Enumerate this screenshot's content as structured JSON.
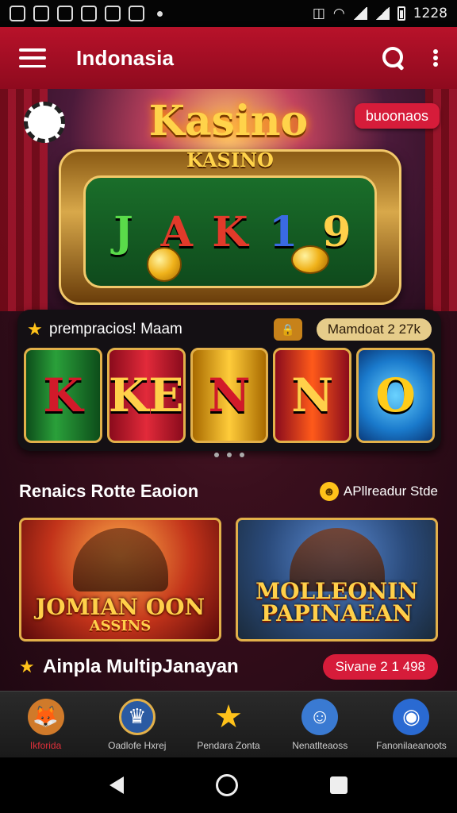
{
  "status": {
    "time": "1228"
  },
  "app_bar": {
    "title": "Indonasia"
  },
  "hero": {
    "title": "Kasino",
    "promo": "buoonaos",
    "slot_label": "KASINO",
    "symbols": [
      "J",
      "A",
      "K",
      "1",
      "9"
    ]
  },
  "featured": {
    "title": "prempracios! Maam",
    "jackpot": "Mamdoat 2 27k",
    "reels": [
      "K",
      "KE",
      "N",
      "N",
      "O"
    ]
  },
  "section": {
    "title": "Renaics Rotte Eaoion",
    "link": "APllreadur Stde"
  },
  "cards": [
    {
      "title": "JOMIAN OON",
      "sub": "ASSINS"
    },
    {
      "title": "MOLLEONIN PAPINAEAN",
      "sub": ""
    }
  ],
  "section2": {
    "title": "Ainpla MultipJanayan",
    "pill": "Sivane 2 1 498"
  },
  "bottom_nav": [
    {
      "label": "Ikforida",
      "icon": "fox-icon"
    },
    {
      "label": "Oadlofe Hxrej",
      "icon": "casino-badge-icon"
    },
    {
      "label": "Pendara Zonta",
      "icon": "star-icon"
    },
    {
      "label": "Nenatlteaoss",
      "icon": "chat-icon"
    },
    {
      "label": "Fanonilaeanoots",
      "icon": "profile-icon"
    }
  ],
  "colors": {
    "app_bar": "#b8122a",
    "accent_red": "#d61c3a",
    "gold": "#ffd04a"
  }
}
